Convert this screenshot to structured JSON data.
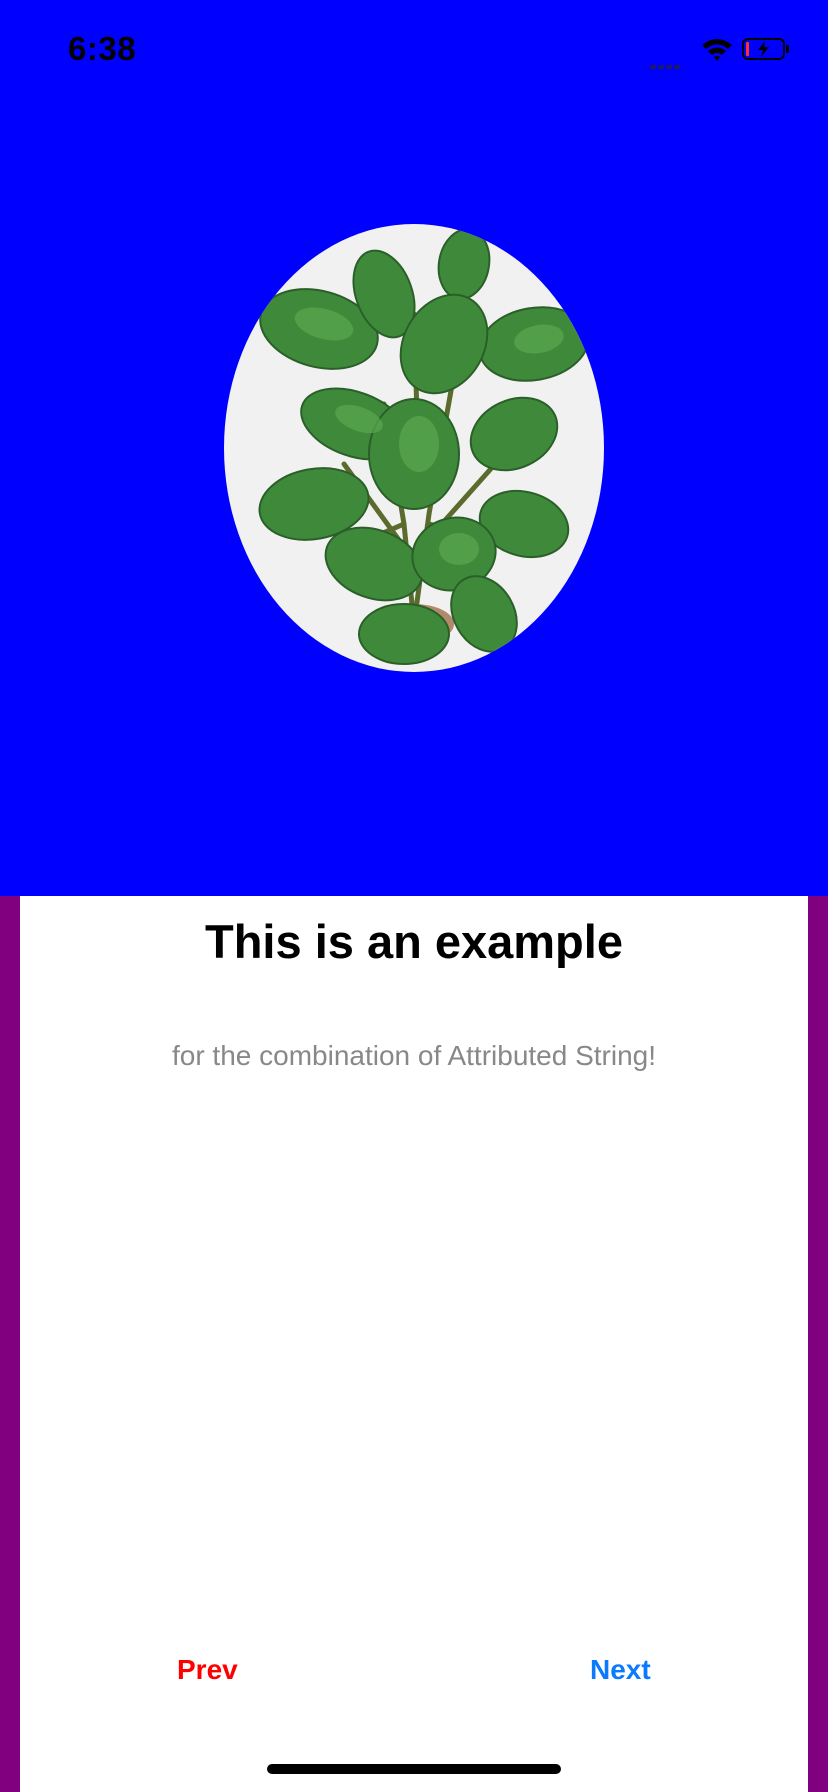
{
  "status_bar": {
    "time": "6:38",
    "icons": [
      "cell-signal-icon",
      "wifi-icon",
      "battery-charging-icon"
    ]
  },
  "hero": {
    "background_color": "#0000FF",
    "image": "potted-plant-photo"
  },
  "content": {
    "title": "This is an example",
    "subtitle": "for the combination of Attributed String!"
  },
  "nav": {
    "prev_label": "Prev",
    "next_label": "Next",
    "prev_color": "#FF0000",
    "next_color": "#0A7AFF"
  },
  "colors": {
    "side_border": "#800080",
    "card": "#FFFFFF"
  }
}
